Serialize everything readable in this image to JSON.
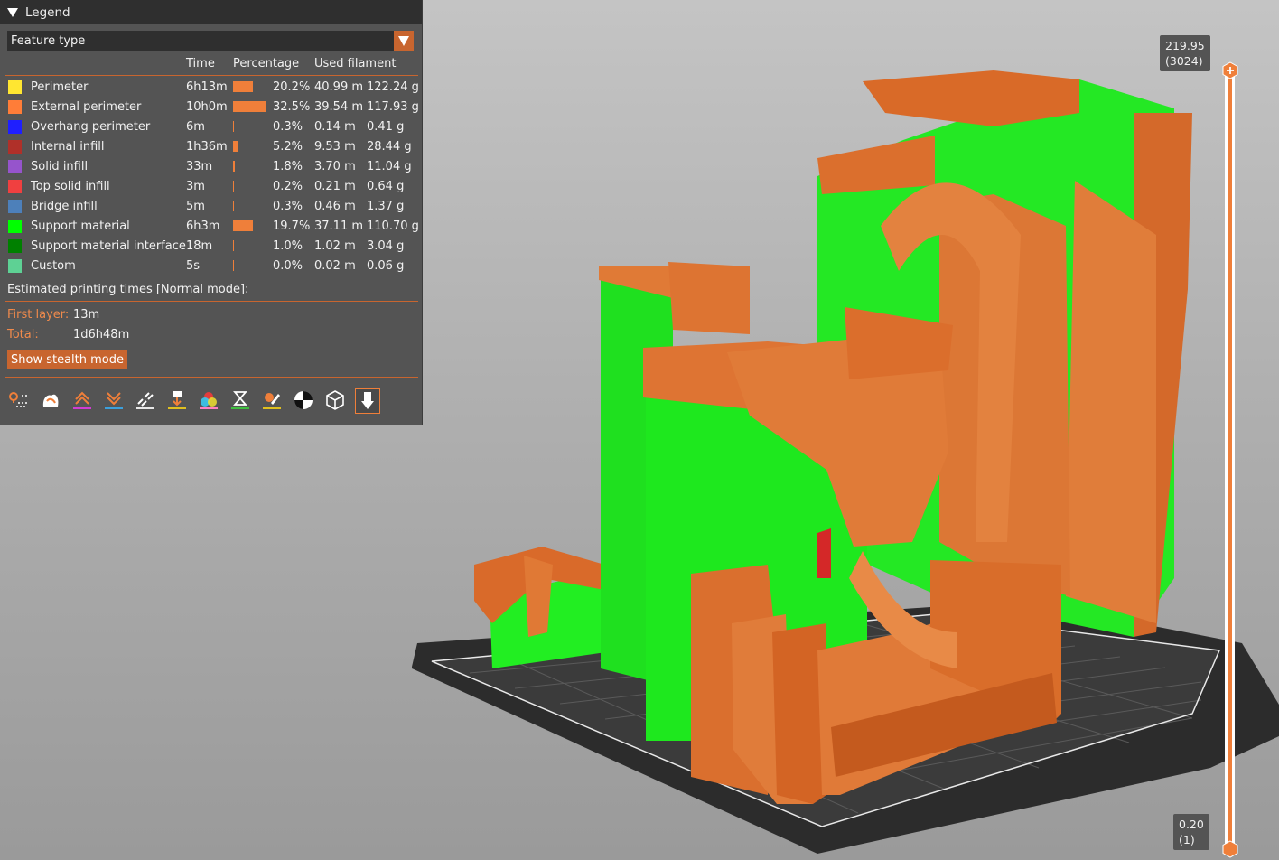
{
  "legend": {
    "title": "Legend",
    "view_type": "Feature type",
    "columns": [
      "Time",
      "Percentage",
      "Used filament"
    ],
    "items": [
      {
        "name": "Perimeter",
        "color": "#ffe631",
        "time": "6h13m",
        "percent": "20.2%",
        "percent_value": 20.2,
        "length": "40.99 m",
        "weight": "122.24 g"
      },
      {
        "name": "External perimeter",
        "color": "#ff7d38",
        "time": "10h0m",
        "percent": "32.5%",
        "percent_value": 32.5,
        "length": "39.54 m",
        "weight": "117.93 g"
      },
      {
        "name": "Overhang perimeter",
        "color": "#1f1fff",
        "time": "6m",
        "percent": "0.3%",
        "percent_value": 0.3,
        "length": "0.14 m",
        "weight": "0.41 g"
      },
      {
        "name": "Internal infill",
        "color": "#b03029",
        "time": "1h36m",
        "percent": "5.2%",
        "percent_value": 5.2,
        "length": "9.53 m",
        "weight": "28.44 g"
      },
      {
        "name": "Solid infill",
        "color": "#9654cc",
        "time": "33m",
        "percent": "1.8%",
        "percent_value": 1.8,
        "length": "3.70 m",
        "weight": "11.04 g"
      },
      {
        "name": "Top solid infill",
        "color": "#f04040",
        "time": "3m",
        "percent": "0.2%",
        "percent_value": 0.2,
        "length": "0.21 m",
        "weight": "0.64 g"
      },
      {
        "name": "Bridge infill",
        "color": "#4d80ba",
        "time": "5m",
        "percent": "0.3%",
        "percent_value": 0.3,
        "length": "0.46 m",
        "weight": "1.37 g"
      },
      {
        "name": "Support material",
        "color": "#00ff00",
        "time": "6h3m",
        "percent": "19.7%",
        "percent_value": 19.7,
        "length": "37.11 m",
        "weight": "110.70 g"
      },
      {
        "name": "Support material interface",
        "color": "#008000",
        "time": "18m",
        "percent": "1.0%",
        "percent_value": 1.0,
        "length": "1.02 m",
        "weight": "3.04 g"
      },
      {
        "name": "Custom",
        "color": "#5ed194",
        "time": "5s",
        "percent": "0.0%",
        "percent_value": 0.0,
        "length": "0.02 m",
        "weight": "0.06 g"
      }
    ],
    "estimated_title": "Estimated printing times [Normal mode]:",
    "first_layer_label": "First layer:",
    "first_layer_value": "13m",
    "total_label": "Total:",
    "total_value": "1d6h48m",
    "stealth_button": "Show stealth mode",
    "toolbar": [
      "travel-icon",
      "wipe-icon",
      "retractions-icon",
      "deretractions-icon",
      "seams-icon",
      "tool-changes-icon",
      "color-changes-icon",
      "pause-prints-icon",
      "custom-gcodes-icon",
      "center-of-gravity-icon",
      "shells-icon",
      "tool-marker-icon"
    ]
  },
  "slider": {
    "top_height": "219.95",
    "top_layer": "(3024)",
    "bottom_height": "0.20",
    "bottom_layer": "(1)",
    "range_fraction": 1.0
  }
}
